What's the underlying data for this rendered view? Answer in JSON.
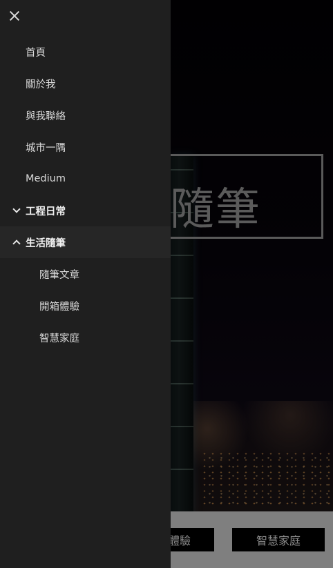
{
  "background": {
    "title": "隨筆",
    "buttons": [
      "體驗",
      "智慧家庭"
    ]
  },
  "drawer": {
    "close_icon": "close-icon",
    "items": [
      {
        "label": "首頁"
      },
      {
        "label": "關於我"
      },
      {
        "label": "與我聯絡"
      },
      {
        "label": "城市一隅"
      },
      {
        "label": "Medium"
      },
      {
        "label": "工程日常",
        "icon": "chevron-down-icon"
      },
      {
        "label": "生活隨筆",
        "icon": "chevron-up-icon"
      },
      {
        "label": "隨筆文章"
      },
      {
        "label": "開箱體驗"
      },
      {
        "label": "智慧家庭"
      }
    ]
  }
}
